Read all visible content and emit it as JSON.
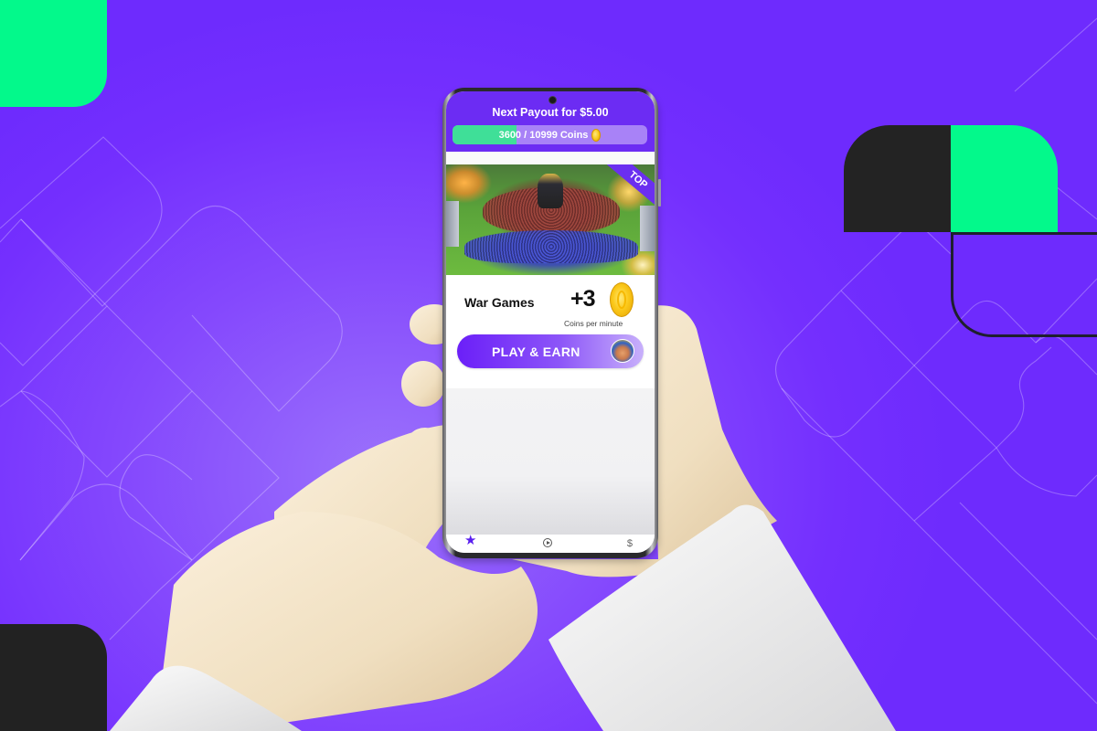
{
  "colors": {
    "background_purple": "#742ffe",
    "accent_green": "#03f98b",
    "dark_block": "#222222",
    "app_header": "#6c2cf3",
    "progress_fill": "#3fdf98",
    "progress_track": "#a882f7",
    "coin_gold": "#fbc91b"
  },
  "app": {
    "header": {
      "payout_title": "Next Payout for $5.00",
      "progress": {
        "current": 3600,
        "target": 10999,
        "label": "3600 / 10999 Coins",
        "icon": "coin-icon"
      }
    },
    "featured_game": {
      "badge": "TOP",
      "name": "War Games",
      "reward": "+3",
      "reward_caption": "Coins per minute",
      "reward_icon": "coin-icon",
      "cta_label": "PLAY & EARN",
      "cta_icon": "game-avatar-icon"
    },
    "bottom_nav": [
      {
        "name": "home",
        "icon": "star-icon",
        "active": true
      },
      {
        "name": "play",
        "icon": "play-circle-icon",
        "active": false
      },
      {
        "name": "cashout",
        "icon": "dollar-icon",
        "active": false
      }
    ]
  }
}
